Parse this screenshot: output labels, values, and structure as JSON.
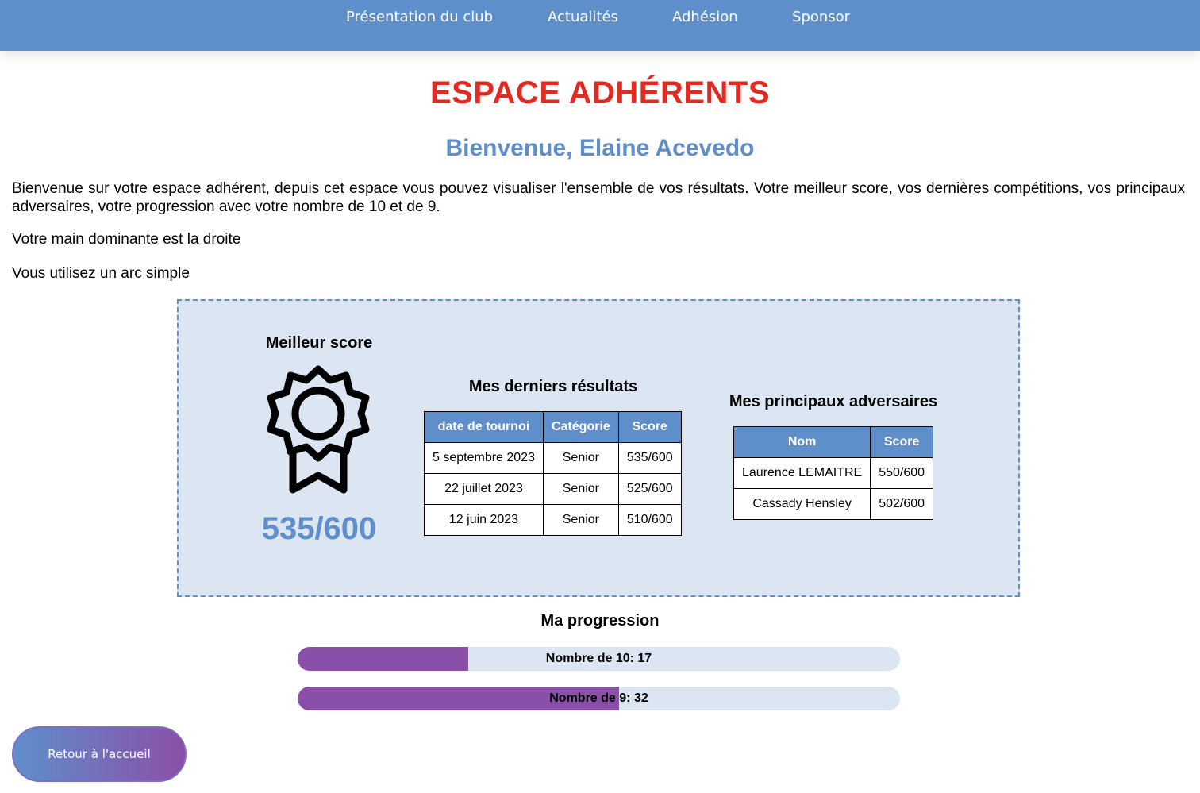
{
  "nav": {
    "items": [
      "Présentation du club",
      "Actualités",
      "Adhésion",
      "Sponsor"
    ]
  },
  "page": {
    "title": "ESPACE ADHÉRENTS",
    "welcome": "Bienvenue, Elaine Acevedo",
    "intro": "Bienvenue sur votre espace adhérent, depuis cet espace vous pouvez visualiser l'ensemble de vos résultats. Votre meilleur score, vos dernières compétitions, vos principaux adversaires, votre progression avec votre nombre de 10 et de 9.",
    "dominant_hand": "Votre main dominante est la droite",
    "bow_type": "Vous utilisez un arc simple"
  },
  "best_score": {
    "heading": "Meilleur score",
    "icon": "award-ribbon-icon",
    "value": "535/600"
  },
  "results": {
    "heading": "Mes derniers résultats",
    "columns": [
      "date de tournoi",
      "Catégorie",
      "Score"
    ],
    "rows": [
      [
        "5 septembre 2023",
        "Senior",
        "535/600"
      ],
      [
        "22 juillet 2023",
        "Senior",
        "525/600"
      ],
      [
        "12 juin 2023",
        "Senior",
        "510/600"
      ]
    ]
  },
  "opponents": {
    "heading": "Mes principaux adversaires",
    "columns": [
      "Nom",
      "Score"
    ],
    "rows": [
      [
        "Laurence LEMAITRE",
        "550/600"
      ],
      [
        "Cassady Hensley",
        "502/600"
      ]
    ]
  },
  "progression": {
    "heading": "Ma progression",
    "bars": [
      {
        "label": "Nombre de 10: 17",
        "fill_percent": 28.3
      },
      {
        "label": "Nombre de 9: 32",
        "fill_percent": 53.3
      }
    ]
  },
  "home_button": {
    "label": "Retour à l'accueil"
  },
  "colors": {
    "primary_blue": "#5f8fcb",
    "title_red": "#e32a22",
    "panel_bg": "#dce5f2",
    "progress_purple": "#8a4fa8"
  }
}
